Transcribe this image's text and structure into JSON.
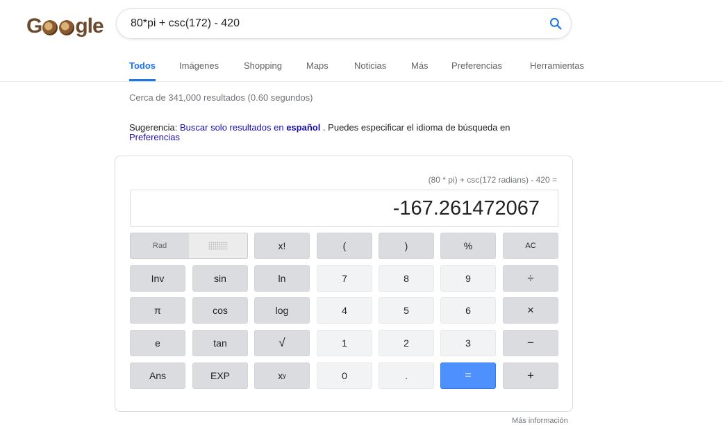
{
  "logo": {
    "text_pre": "G",
    "text_post": "gle"
  },
  "search": {
    "query": "80*pi + csc(172) - 420",
    "icon": "search-icon",
    "accent": "#1a73e8"
  },
  "tabs": [
    {
      "label": "Todos",
      "active": true
    },
    {
      "label": "Imágenes"
    },
    {
      "label": "Shopping"
    },
    {
      "label": "Maps"
    },
    {
      "label": "Noticias"
    },
    {
      "label": "Más"
    },
    {
      "label": "Preferencias"
    },
    {
      "label": "Herramientas"
    }
  ],
  "result_stats": "Cerca de 341,000 resultados (0.60 segundos)",
  "suggestion": {
    "prefix": "Sugerencia: ",
    "link_text": "Buscar solo resultados en ",
    "link_bold": "español",
    "middle": " . Puedes especificar el idioma de búsqueda en",
    "prefs_link": "Preferencias"
  },
  "calculator": {
    "expression": "(80 * pi) + csc(172 radians) - 420 =",
    "result": "-167.261472067",
    "mode_rad": "Rad",
    "keys": {
      "fact": "x!",
      "lparen": "(",
      "rparen": ")",
      "percent": "%",
      "ac": "AC",
      "inv": "Inv",
      "sin": "sin",
      "ln": "ln",
      "n7": "7",
      "n8": "8",
      "n9": "9",
      "divide": "÷",
      "pi": "π",
      "cos": "cos",
      "log": "log",
      "n4": "4",
      "n5": "5",
      "n6": "6",
      "multiply": "×",
      "e": "e",
      "tan": "tan",
      "sqrt": "√",
      "n1": "1",
      "n2": "2",
      "n3": "3",
      "minus": "−",
      "ans": "Ans",
      "exp": "EXP",
      "pow_base": "x",
      "pow_sup": "y",
      "n0": "0",
      "dot": ".",
      "equals": "=",
      "plus": "+"
    },
    "equals_color": "#4d90fe"
  },
  "more_info": "Más información"
}
